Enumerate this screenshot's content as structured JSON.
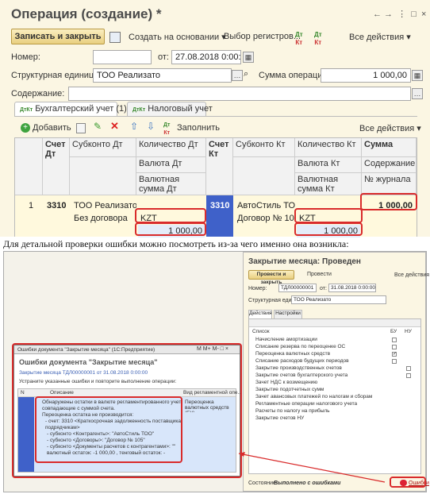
{
  "window": {
    "title": "Операция (создание) *",
    "nav_icons": "- □ ×"
  },
  "toolbar": {
    "save_close": "Записать и закрыть",
    "create_based": "Создать на основании ▾",
    "register": "Выбор регистров...",
    "all_actions": "Все действия ▾"
  },
  "form": {
    "number_label": "Номер:",
    "number_value": "",
    "from_label": "от:",
    "date_value": "27.08.2018 0:00:00",
    "unit_label": "Структурная единица:",
    "unit_value": "ТОО Реализато",
    "sum_label": "Сумма операции:",
    "sum_value": "1 000,00",
    "content_label": "Содержание:",
    "content_value": ""
  },
  "tabs": [
    {
      "label": "Бухгалтерский учет (1)"
    },
    {
      "label": "Налоговый учет"
    }
  ],
  "tab_toolbar": {
    "add": "Добавить",
    "fill": "Заполнить",
    "all_actions": "Все действия ▾"
  },
  "table": {
    "headers": {
      "dt_account": "Счет Дт",
      "subconto_dt": "Субконто Дт",
      "qty_dt": "Количество Дт",
      "currency_dt": "Валюта Дт",
      "cur_sum_dt": "Валютная сумма Дт",
      "kt_account": "Счет Кт",
      "subconto_kt": "Субконто Кт",
      "qty_kt": "Количество Кт",
      "currency_kt": "Валюта Кт",
      "cur_sum_kt": "Валютная сумма Кт",
      "sum": "Сумма",
      "content": "Содержание",
      "journal": "№ журнала"
    },
    "row": {
      "n": "1",
      "dt_account": "3310",
      "subconto_dt_1": "ТОО Реализато",
      "subconto_dt_2": "Без договора",
      "currency_dt": "KZT",
      "cur_sum_dt": "1 000,00",
      "kt_account": "3310",
      "subconto_kt_1": "АвтоСтиль ТОО",
      "subconto_kt_2": "Договор № 105",
      "currency_kt": "KZT",
      "cur_sum_kt": "1 000,00",
      "sum": "1 000,00"
    }
  },
  "caption": "Для детальной проверки ошибки можно посмотреть из-за чего именно она возникла:",
  "closing": {
    "title": "Закрытие месяца: Проведен",
    "btn_post_close": "Провести и закрыть",
    "btn_post": "Провести",
    "all_actions": "Все действия ▾",
    "number_label": "Номер:",
    "number_value": "ТДЛ00000001",
    "from_label": "от:",
    "date_value": "31.08.2018 0:00:00",
    "unit_label": "Структурная единица:",
    "unit_value": "ТОО Реализато",
    "tabs": [
      "Действия",
      "Настройки"
    ],
    "list_header": "Список",
    "col_bu": "БУ",
    "col_nu": "НУ",
    "items": [
      "Начисление амортизации",
      "Списание резерва по переоценке ОС",
      "Переоценка валютных средств",
      "Списание расходов будущих периодов",
      "Закрытие производственных счетов",
      "Закрытие счетов бухгалтерского учета",
      "Зачет НДС к возмещению",
      "Закрытие подотчетных сумм",
      "Зачет авансовых платежей по налогам и сборам",
      "Регламентные операции налогового учета",
      "Расчеты по налогу на прибыль",
      "Закрытие счетов НУ"
    ],
    "state_label": "Состояние:",
    "state_value": "Выполнено с ошибками",
    "errors_link": "Ошибки"
  },
  "errors": {
    "window_title": "Ошибки документа \"Закрытие месяца\" (1С:Предприятие)",
    "heading": "Ошибки документа \"Закрытие месяца\"",
    "doc_link": "Закрытие месяца ТДЛ00000001 от 31.08.2018 0:00:00",
    "hint": "Устраните указанные ошибки и повторите выполнение операции:",
    "col_n": "N",
    "col_desc": "Описание",
    "col_type": "Вид регламентной опе...",
    "desc_lines": [
      "Обнаружены остатки в валюте регламентированного учета, не",
      "совпадающие с суммой счета.",
      "Переоценка остатка не производится:",
      "- счет: 3310 <Краткосрочная задолженность поставщикам и",
      "подрядчикам>",
      "- субконто <Контрагенты>: \"АвтоСтиль ТОО\"",
      "- субконто <Договоры>: \"Договор № 105\"",
      "- субконто <Документы расчетов с контрагентами>: \"\"",
      "валютный остаток: -1 000,00 , тенговый остаток: -"
    ],
    "type_value": "Переоценка валютных средств (БУ)"
  }
}
